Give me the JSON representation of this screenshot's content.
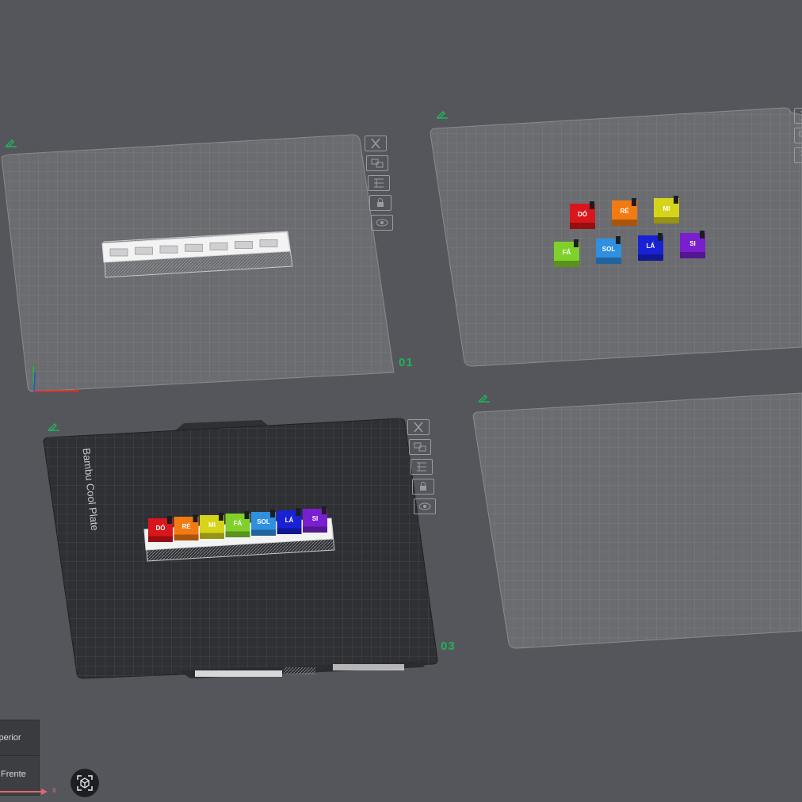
{
  "plates": [
    {
      "number": "01",
      "style": "light",
      "has_object": "holder"
    },
    {
      "number": "",
      "style": "light",
      "has_object": "blocks"
    },
    {
      "number": "03",
      "style": "dark",
      "has_object": "holder-with-blocks",
      "plate_name": "Bambu Cool Plate"
    },
    {
      "number": "",
      "style": "light",
      "has_object": "none"
    }
  ],
  "notes": [
    "DÓ",
    "RÉ",
    "MI",
    "FÁ",
    "SOL",
    "LÁ",
    "SI"
  ],
  "note_colors": [
    "#d9161b",
    "#f27a12",
    "#d6d41a",
    "#7fd12a",
    "#2f8fe0",
    "#1822d4",
    "#7a1fd0"
  ],
  "view_cube": {
    "top_label": "Superior",
    "front_label": "Frente"
  },
  "axis": {
    "x_label": "x"
  },
  "colors": {
    "background": "#55565b",
    "plate_light": "#6b6c70",
    "plate_dark": "#2f3034",
    "plate_number": "#1fb35a"
  },
  "icons": {
    "toolbar": [
      "close-icon",
      "arrange-icon",
      "orient-icon",
      "lock-icon",
      "eye-icon"
    ],
    "edit": "pencil-icon",
    "fit": "view-fit-icon"
  }
}
